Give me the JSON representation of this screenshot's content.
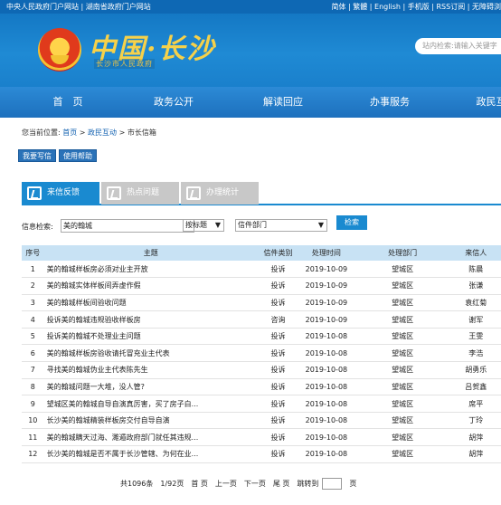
{
  "topbar": {
    "left": "中央人民政府门户网站 | 湖南省政府门户网站",
    "right": "简体 | 繁體 | English | 手机版 | RSS订阅 | 无障碍浏"
  },
  "header": {
    "logo": "中国·长沙",
    "logo_sub": "长沙市人民政府",
    "search_placeholder": "站内检索:请输入关键字"
  },
  "nav": [
    "首　页",
    "政务公开",
    "解读回应",
    "办事服务",
    "政民互"
  ],
  "breadcrumb": {
    "prefix": "您当前位置: ",
    "items": [
      "首页",
      "政民互动"
    ],
    "current": "市长信箱",
    "sep": " > "
  },
  "actions": [
    "我要写信",
    "使用帮助"
  ],
  "tabs": [
    "来信反馈",
    "热点问题",
    "办理统计"
  ],
  "search": {
    "label": "信息检索:",
    "keyword": "美的翰城",
    "type_select": "按标题",
    "dept_select": "信件部门",
    "button": "检索"
  },
  "table": {
    "headers": [
      "序号",
      "主题",
      "信件类别",
      "处理时间",
      "处理部门",
      "来信人"
    ],
    "rows": [
      [
        "1",
        "美的翰城样板房必须对业主开放",
        "投诉",
        "2019-10-09",
        "望城区",
        "陈晨"
      ],
      [
        "2",
        "美的翰城实体样板间弄虚作假",
        "投诉",
        "2019-10-09",
        "望城区",
        "张谦"
      ],
      [
        "3",
        "美的翰城样板间验收问题",
        "投诉",
        "2019-10-09",
        "望城区",
        "袁红菊"
      ],
      [
        "4",
        "投诉美的翰城违规验收样板房",
        "咨询",
        "2019-10-09",
        "望城区",
        "谢军"
      ],
      [
        "5",
        "投诉美的翰城不处理业主问题",
        "投诉",
        "2019-10-08",
        "望城区",
        "王雯"
      ],
      [
        "6",
        "美的翰城样板房验收请托冒充业主代表",
        "投诉",
        "2019-10-08",
        "望城区",
        "李浩"
      ],
      [
        "7",
        "寻找美的翰城伪业主代表陈先生",
        "投诉",
        "2019-10-08",
        "望城区",
        "胡勇乐"
      ],
      [
        "8",
        "美的翰城问题一大堆，没人管?",
        "投诉",
        "2019-10-08",
        "望城区",
        "吕贺鑫"
      ],
      [
        "9",
        "望城区美的翰城自导自演真厉害，买了房子白...",
        "投诉",
        "2019-10-08",
        "望城区",
        "席平"
      ],
      [
        "10",
        "长沙美的翰城精装样板房交付自导自演",
        "投诉",
        "2019-10-08",
        "望城区",
        "丁玲"
      ],
      [
        "11",
        "美的翰城瞒天过海、濉遁政府部门就任其违规...",
        "投诉",
        "2019-10-08",
        "望城区",
        "胡萍"
      ],
      [
        "12",
        "长沙美的翰城是否不属于长沙管辖、为何在业...",
        "投诉",
        "2019-10-08",
        "望城区",
        "胡萍"
      ]
    ]
  },
  "pager": {
    "total": "共1096条",
    "page": "1/92页",
    "first": "首 页",
    "prev": "上一页",
    "next": "下一页",
    "last": "尾 页",
    "jump": "跳转到",
    "unit": "页"
  }
}
